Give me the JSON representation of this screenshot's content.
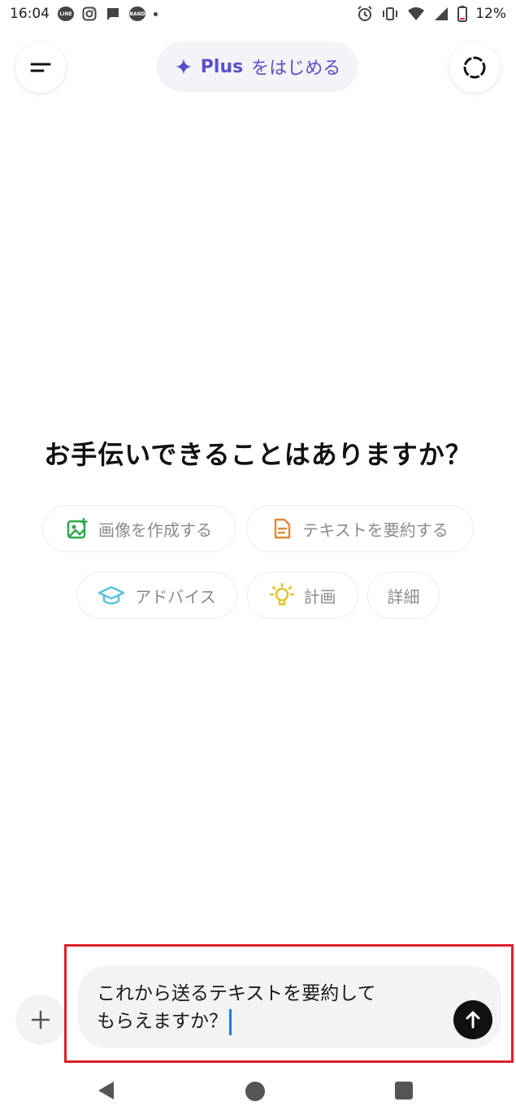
{
  "status_bar": {
    "time": "16:04",
    "battery": "12%",
    "notifications": [
      "LINE",
      "BAND"
    ]
  },
  "header": {
    "plus_label": "Plus",
    "plus_suffix": "をはじめる"
  },
  "main": {
    "headline": "お手伝いできることはありますか？",
    "chips": [
      {
        "label": "画像を作成する",
        "icon": "image-create-icon",
        "color": "#2fa84f"
      },
      {
        "label": "テキストを要約する",
        "icon": "document-icon",
        "color": "#e08a3c"
      },
      {
        "label": "アドバイス",
        "icon": "graduation-cap-icon",
        "color": "#5bc0de"
      },
      {
        "label": "計画",
        "icon": "lightbulb-icon",
        "color": "#e6c229"
      },
      {
        "label": "詳細",
        "icon": "",
        "color": ""
      }
    ]
  },
  "composer": {
    "line1": "これから送るテキストを要約して",
    "line2": "もらえますか？"
  },
  "colors": {
    "accent": "#5b4fc9",
    "highlight": "#e0202a",
    "caret": "#1f7ae0"
  }
}
